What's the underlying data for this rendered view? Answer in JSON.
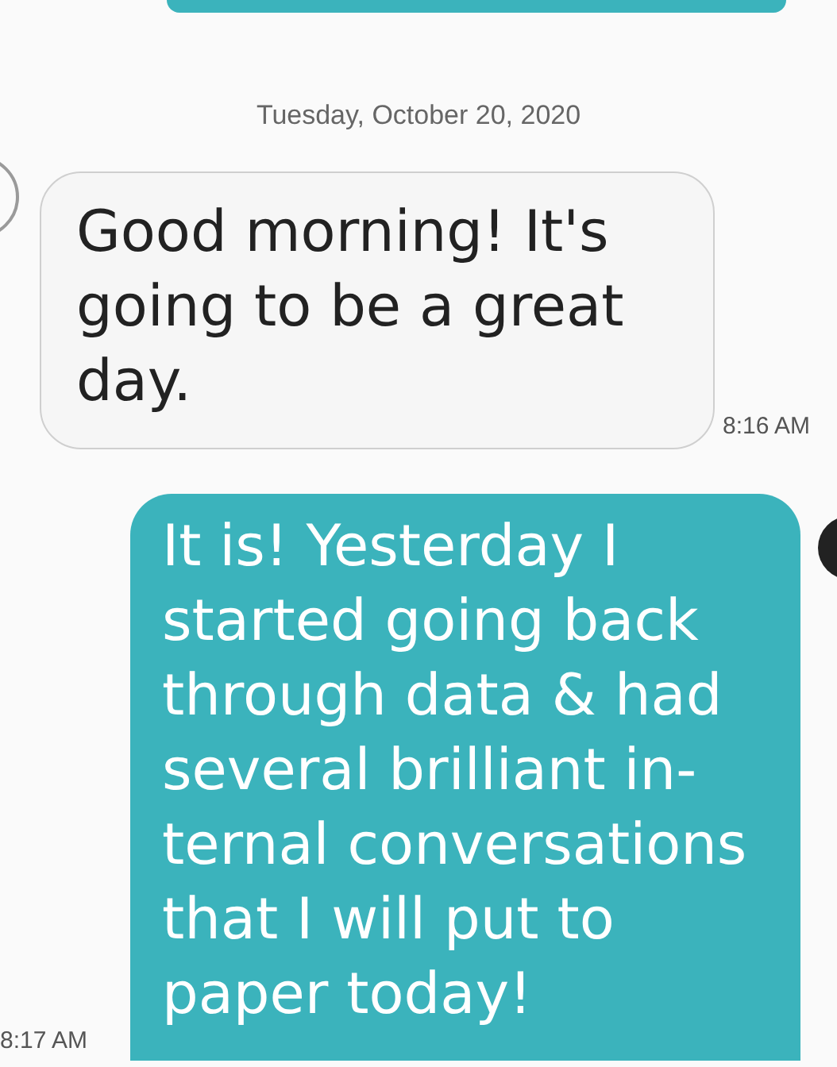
{
  "date_divider": "Tuesday, October 20, 2020",
  "messages": [
    {
      "kind": "received",
      "text": "Good morning! It's going to be a great day.",
      "time": "8:16 AM"
    },
    {
      "kind": "sent",
      "text": "It is! Yesterday I started going back through data & had several brilliant in-ternal conversations that I will put to paper today!",
      "time": "8:17 AM"
    }
  ]
}
